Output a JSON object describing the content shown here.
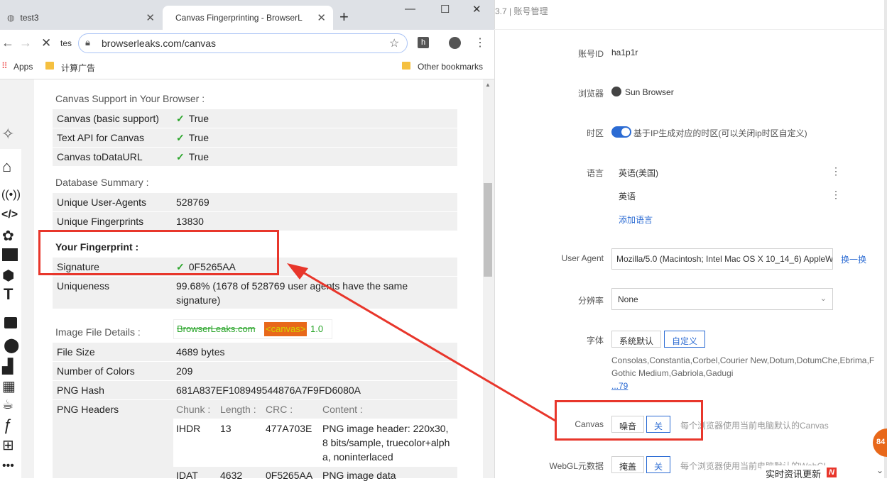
{
  "browser": {
    "tabs": [
      {
        "label": "test3"
      },
      {
        "label": "Canvas Fingerprinting - BrowserL"
      }
    ],
    "address_prefix": "tes",
    "url": "browserleaks.com/canvas",
    "bookmarks": {
      "apps": "Apps",
      "folder": "计算广告",
      "other": "Other bookmarks"
    },
    "ext_h": "h"
  },
  "canvas_support": {
    "title": "Canvas Support in Your Browser :",
    "rows": [
      {
        "label": "Canvas (basic support)",
        "value": "True"
      },
      {
        "label": "Text API for Canvas",
        "value": "True"
      },
      {
        "label": "Canvas toDataURL",
        "value": "True"
      }
    ]
  },
  "database": {
    "title": "Database Summary :",
    "rows": [
      {
        "label": "Unique User-Agents",
        "value": "528769"
      },
      {
        "label": "Unique Fingerprints",
        "value": "13830"
      }
    ]
  },
  "fingerprint": {
    "title": "Your Fingerprint :",
    "signature_label": "Signature",
    "signature_value": "0F5265AA",
    "uniqueness_label": "Uniqueness",
    "uniqueness_value_1": "99.68% (1678 of 528769 user agents have the same",
    "uniqueness_value_2": "signature)"
  },
  "image_file": {
    "title": "Image File Details :",
    "preview": {
      "site": "BrowserLeaks.com",
      "tag": "<canvas>",
      "version": "1.0"
    },
    "rows": [
      {
        "label": "File Size",
        "value": "4689 bytes"
      },
      {
        "label": "Number of Colors",
        "value": "209"
      },
      {
        "label": "PNG Hash",
        "value": "681A837EF108949544876A7F9FD6080A"
      }
    ],
    "headers_label": "PNG Headers",
    "headers_cols": [
      "Chunk :",
      "Length :",
      "CRC :",
      "Content :"
    ],
    "headers_rows": [
      {
        "chunk": "IHDR",
        "length": "13",
        "crc": "477A703E",
        "content_1": "PNG image header: 220x30,",
        "content_2": "8 bits/sample, truecolor+alph",
        "content_3": "a, noninterlaced"
      },
      {
        "chunk": "IDAT",
        "length": "4632",
        "crc": "0F5265AA",
        "content_1": "PNG image data"
      }
    ]
  },
  "right_panel": {
    "header": "3.7 | 账号管理",
    "account_id_label": "账号ID",
    "account_id": "ha1p1r",
    "browser_label": "浏览器",
    "browser_value": "Sun Browser",
    "timezone_label": "时区",
    "timezone_text": "基于IP生成对应的时区(可以关闭ip时区自定义)",
    "language_label": "语言",
    "languages": [
      "英语(美国)",
      "英语"
    ],
    "add_language": "添加语言",
    "ua_label": "User Agent",
    "ua_value": "Mozilla/5.0 (Macintosh; Intel Mac OS X 10_14_6) AppleW",
    "ua_change": "换一换",
    "resolution_label": "分辨率",
    "resolution_value": "None",
    "font_label": "字体",
    "font_btn_default": "系统默认",
    "font_btn_custom": "自定义",
    "font_list_1": "Consolas,Constantia,Corbel,Courier New,Dotum,DotumChe,Ebrima,F",
    "font_list_2": "Gothic Medium,Gabriola,Gadugi",
    "font_more": "...79",
    "canvas_label": "Canvas",
    "canvas_noise": "噪音",
    "canvas_off": "关",
    "canvas_desc": "每个浏览器使用当前电脑默认的Canvas",
    "webgl_label": "WebGL元数据",
    "webgl_mask": "掩盖",
    "webgl_off": "关",
    "webgl_desc": "每个浏览器使用当前电脑默认的WebGL",
    "news_badge": "实时资讯更新",
    "news_n": "N",
    "orange_badge": "84"
  },
  "colors": {
    "accent_red": "#e8362b",
    "link_blue": "#2b6bd3",
    "check_green": "#2aa52a",
    "orange": "#e8681a"
  }
}
